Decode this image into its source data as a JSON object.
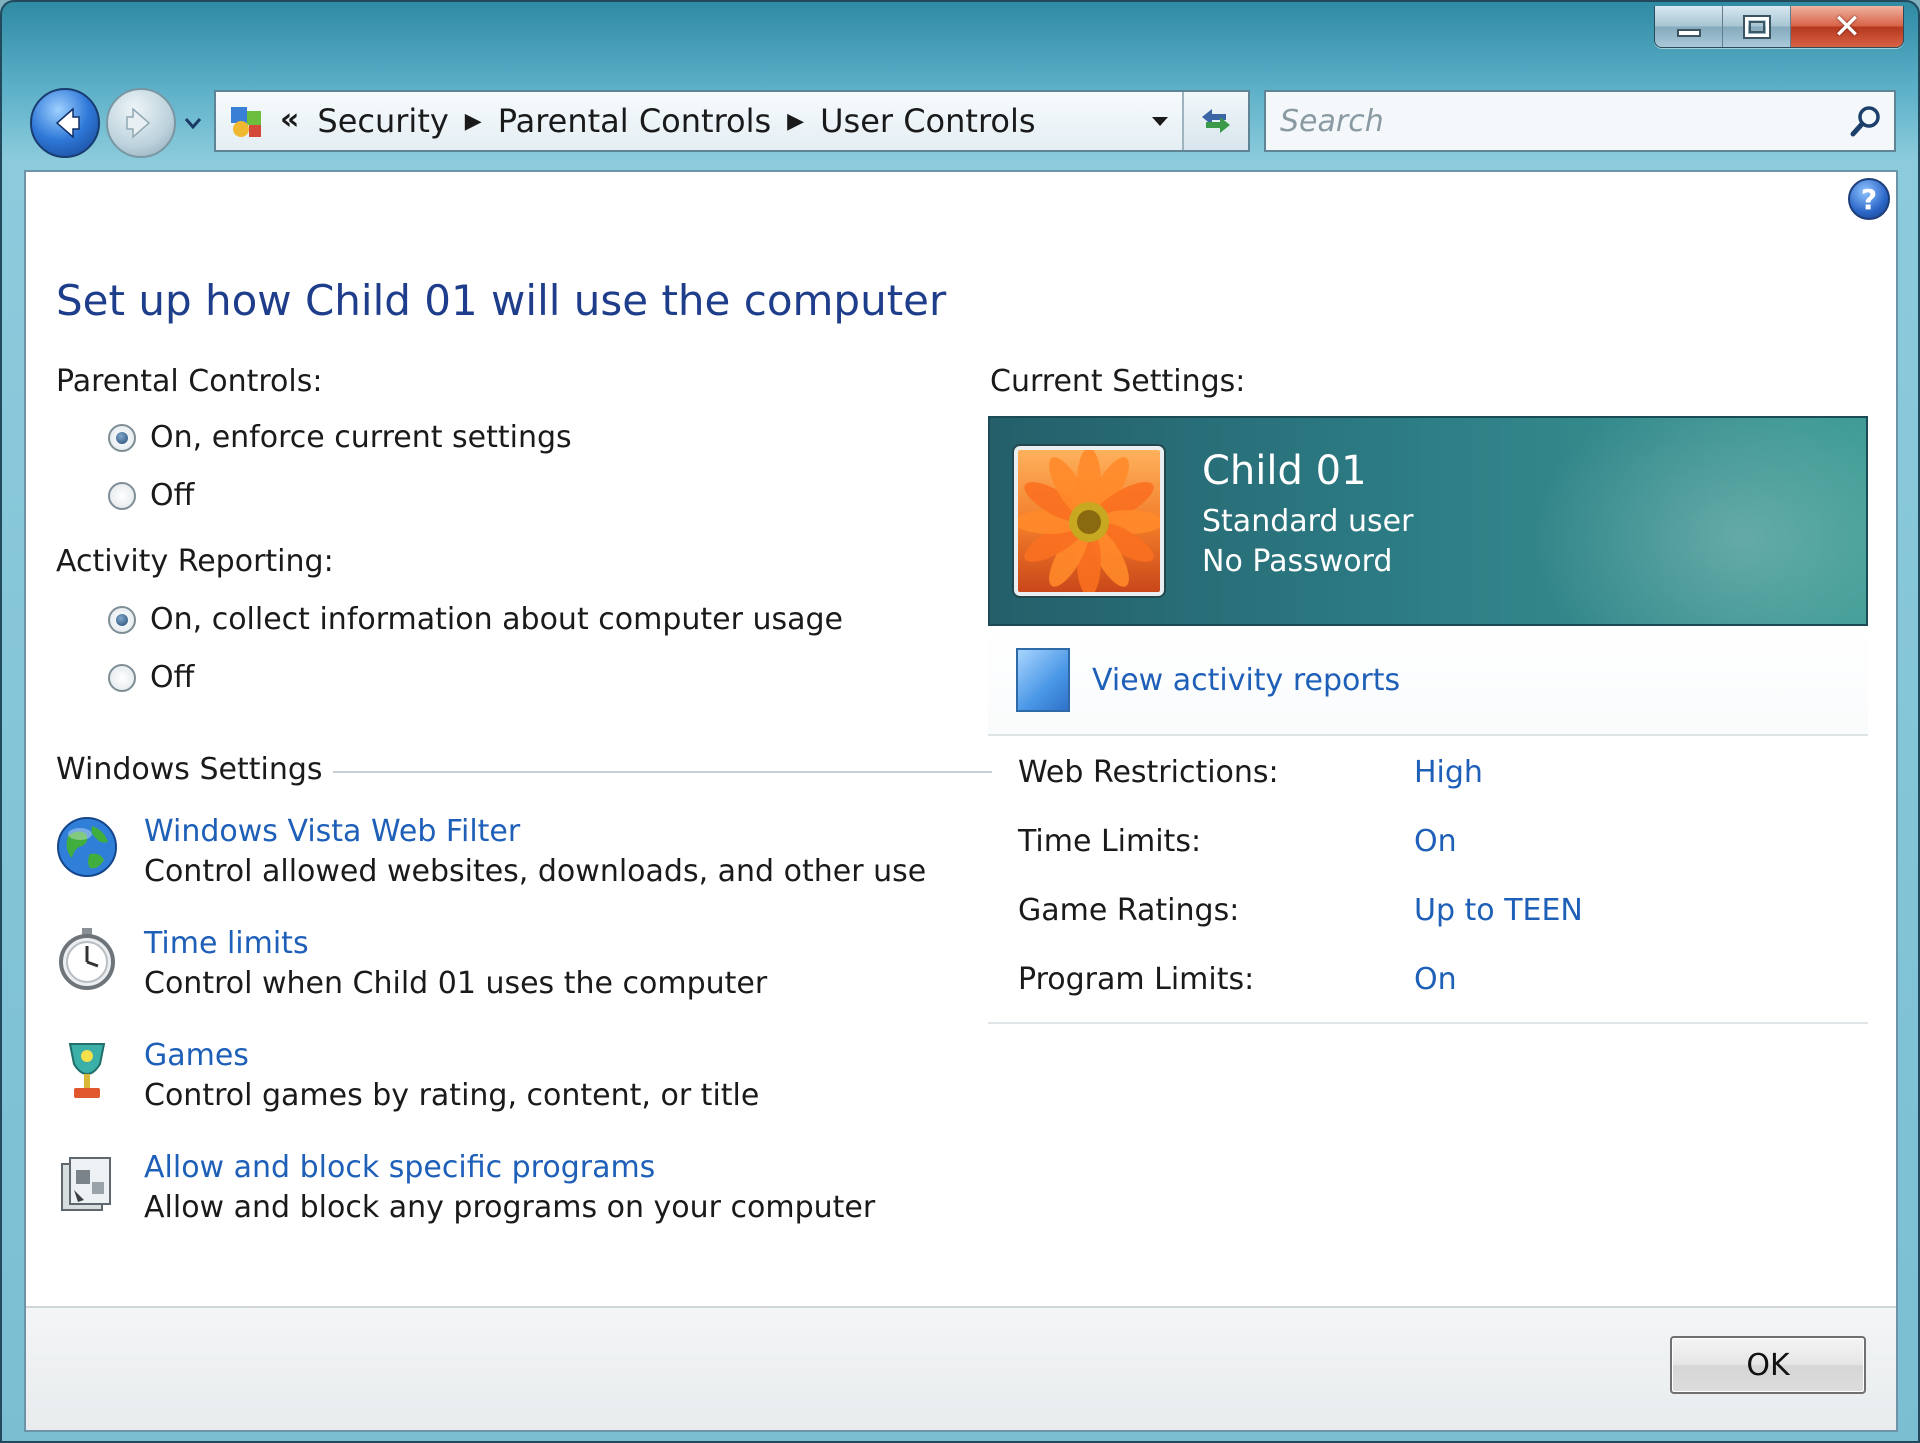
{
  "titlebar": {
    "minimize_icon": "minimize-icon",
    "maximize_icon": "maximize-icon",
    "close_icon": "close-icon",
    "close_glyph": "✕"
  },
  "navigation": {
    "back_icon": "back-arrow-icon",
    "forward_icon": "forward-arrow-icon",
    "lead_chevrons": "«",
    "breadcrumbs": [
      "Security",
      "Parental Controls",
      "User Controls"
    ],
    "separator": "▶"
  },
  "search": {
    "placeholder": "Search"
  },
  "help": {
    "glyph": "?"
  },
  "main": {
    "title": "Set up how Child 01 will use the computer",
    "parental_controls": {
      "label": "Parental Controls:",
      "options": [
        {
          "label": "On, enforce current settings",
          "checked": true
        },
        {
          "label": "Off",
          "checked": false
        }
      ]
    },
    "activity_reporting": {
      "label": "Activity Reporting:",
      "options": [
        {
          "label": "On, collect information about computer usage",
          "checked": true
        },
        {
          "label": "Off",
          "checked": false
        }
      ]
    },
    "windows_settings": {
      "label": "Windows Settings",
      "items": [
        {
          "icon": "globe-icon",
          "link": "Windows Vista Web Filter",
          "desc": "Control allowed websites, downloads, and other use"
        },
        {
          "icon": "stopwatch-icon",
          "link": "Time limits",
          "desc": "Control when Child 01 uses the computer"
        },
        {
          "icon": "trophy-icon",
          "link": "Games",
          "desc": "Control games by rating, content, or title"
        },
        {
          "icon": "programs-icon",
          "link": "Allow and block specific programs",
          "desc": "Allow and block any programs on your computer"
        }
      ]
    }
  },
  "current_settings": {
    "label": "Current Settings:",
    "user": {
      "name": "Child 01",
      "type": "Standard user",
      "password": "No Password",
      "avatar_icon": "flower-avatar-icon"
    },
    "view_reports": "View activity reports",
    "summary": [
      {
        "key": "Web Restrictions:",
        "value": "High"
      },
      {
        "key": "Time Limits:",
        "value": "On"
      },
      {
        "key": "Game Ratings:",
        "value": "Up to TEEN"
      },
      {
        "key": "Program Limits:",
        "value": "On"
      }
    ]
  },
  "footer": {
    "ok_label": "OK"
  },
  "colors": {
    "link": "#1e5fb8",
    "title": "#1e3d8a",
    "card": "#2c7b84"
  }
}
